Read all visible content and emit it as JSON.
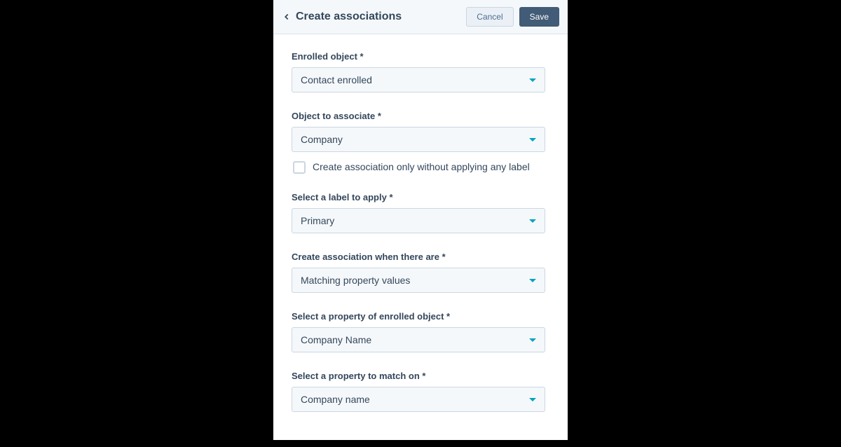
{
  "header": {
    "title": "Create associations",
    "cancel": "Cancel",
    "save": "Save"
  },
  "fields": {
    "enrolled_object": {
      "label": "Enrolled object *",
      "value": "Contact enrolled"
    },
    "object_to_associate": {
      "label": "Object to associate *",
      "value": "Company",
      "checkbox_label": "Create association only without applying any label"
    },
    "label_to_apply": {
      "label": "Select a label to apply *",
      "value": "Primary"
    },
    "create_when": {
      "label": "Create association when there are *",
      "value": "Matching property values"
    },
    "property_enrolled": {
      "label": "Select a property of enrolled object *",
      "value": "Company Name"
    },
    "property_match": {
      "label": "Select a property to match on *",
      "value": "Company name"
    }
  }
}
